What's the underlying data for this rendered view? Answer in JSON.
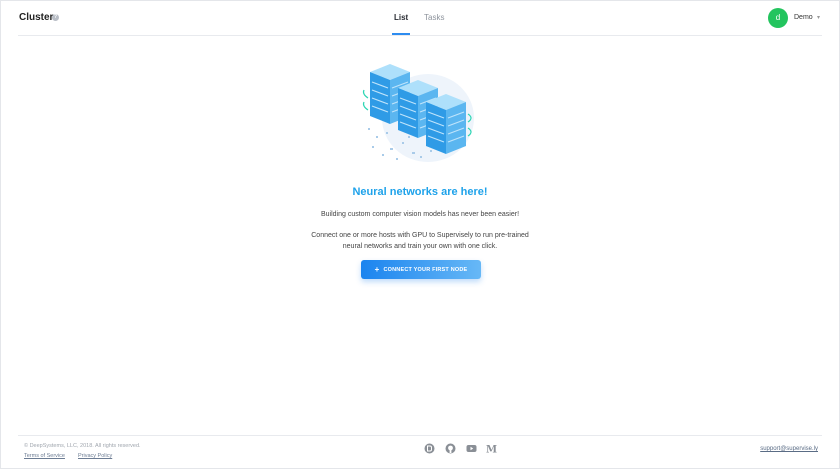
{
  "header": {
    "title": "Cluster",
    "help_icon": "question-circle-icon",
    "tabs": [
      {
        "label": "List",
        "active": true
      },
      {
        "label": "Tasks",
        "active": false
      }
    ],
    "user": {
      "initial": "d",
      "name": "Demo",
      "avatar_color": "#23c45e"
    }
  },
  "hero": {
    "title": "Neural networks are here!",
    "line1": "Building custom computer vision models has never been easier!",
    "line2": "Connect one or more hosts with GPU to Supervisely to run pre-trained neural networks and train your own with one click.",
    "button_label": "CONNECT YOUR FIRST NODE",
    "accent_color": "#1ea2ea"
  },
  "footer": {
    "copyright": "© DeepSystems, LLC, 2018. All rights reserved.",
    "terms": "Terms of Service",
    "privacy": "Privacy Policy",
    "social_icons": [
      "blog-icon",
      "github-icon",
      "youtube-icon",
      "medium-icon"
    ],
    "support_email": "support@supervise.ly"
  }
}
